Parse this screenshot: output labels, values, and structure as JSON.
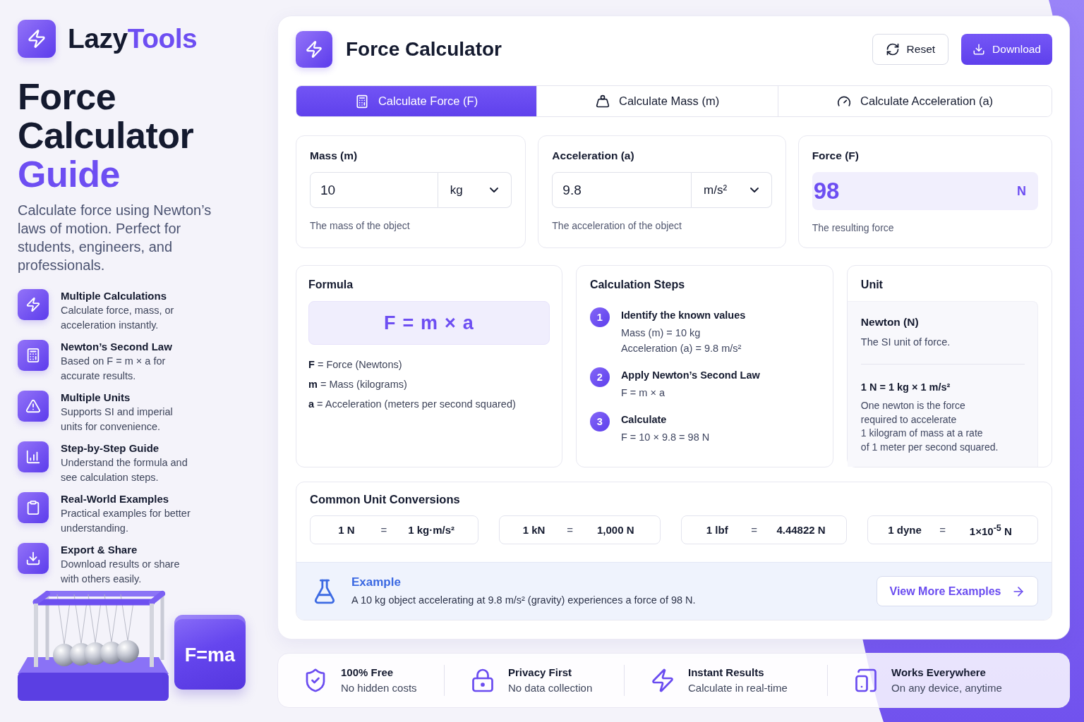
{
  "brand": {
    "name": "Lazy",
    "highlight": "Tools"
  },
  "hero": {
    "title": "Force Calculator",
    "highlight": "Guide",
    "description": "Calculate force using Newton’s laws of motion. Perfect for students, engineers, and professionals."
  },
  "features": [
    {
      "title": "Multiple Calculations",
      "description": "Calculate force, mass, or acceleration instantly."
    },
    {
      "title": "Newton’s Second Law",
      "description": "Based on F = m × a for accurate results."
    },
    {
      "title": "Multiple Units",
      "description": "Supports SI and imperial units for convenience."
    },
    {
      "title": "Step-by-Step Guide",
      "description": "Understand the formula and see calculation steps."
    },
    {
      "title": "Real-World Examples",
      "description": "Practical examples for better understanding."
    },
    {
      "title": "Export & Share",
      "description": "Download results or share with others easily."
    }
  ],
  "illustration": {
    "label": "F=ma"
  },
  "calculator": {
    "title": "Force Calculator",
    "buttons": [
      {
        "label": "Reset",
        "kind": "secondary"
      },
      {
        "label": "Download",
        "kind": "primary"
      }
    ],
    "tabs": [
      {
        "label": "Calculate Force (F)",
        "selected": true
      },
      {
        "label": "Calculate Mass (m)",
        "selected": false
      },
      {
        "label": "Calculate Acceleration (a)",
        "selected": false
      }
    ],
    "inputs": [
      {
        "label": "Mass (m)",
        "value": "10",
        "unit": "kg",
        "help": "The mass of the object"
      },
      {
        "label": "Acceleration (a)",
        "value": "9.8",
        "unit": "m/s²",
        "help": "The acceleration of the object"
      }
    ],
    "result": {
      "label": "Force (F)",
      "value": "98",
      "unit": "N",
      "help": "The resulting force"
    }
  },
  "formula": {
    "title": "Formula",
    "expression": "F = m × a",
    "legend": [
      "**F** = Force (Newtons)",
      "**m** = Mass (kilograms)",
      "**a** = Acceleration (meters per second squared)"
    ]
  },
  "steps": {
    "title": "Calculation Steps",
    "items": [
      {
        "number": "1",
        "title": "Identify the known values",
        "lines": [
          "Mass (m) = 10 kg",
          "Acceleration (a) = 9.8 m/s²"
        ]
      },
      {
        "number": "2",
        "title": "Apply Newton’s Second Law",
        "lines": [
          "F = m × a"
        ]
      },
      {
        "number": "3",
        "title": "Calculate",
        "lines": [
          "F = 10 × 9.8 = 98 N"
        ]
      }
    ]
  },
  "unit": {
    "title": "Unit",
    "name": "Newton (N)",
    "description": "The SI unit of force.",
    "definition": "1 N = 1 kg × 1 m/s²",
    "explanation": "One newton is the force\nrequired to accelerate\n1 kilogram of mass at a rate\nof 1 meter per second squared."
  },
  "conversions": {
    "title": "Common Unit Conversions",
    "items": [
      {
        "from": "1 N",
        "equals": "=",
        "to": "1 kg·m/s²"
      },
      {
        "from": "1 kN",
        "equals": "=",
        "to": "1,000 N"
      },
      {
        "from": "1 lbf",
        "equals": "=",
        "to": "4.44822 N"
      },
      {
        "from": "1 dyne",
        "equals": "=",
        "to": "1×10$^{-5}$ N"
      }
    ]
  },
  "example": {
    "title": "Example",
    "text": "A 10 kg object accelerating at 9.8 m/s² (gravity) experiences a force of 98 N.",
    "button": "View More Examples"
  },
  "footer": [
    {
      "title": "100% Free",
      "subtitle": "No hidden costs"
    },
    {
      "title": "Privacy First",
      "subtitle": "No data collection"
    },
    {
      "title": "Instant Results",
      "subtitle": "Calculate in real-time"
    },
    {
      "title": "Works Everywhere",
      "subtitle": "On any device, anytime"
    }
  ]
}
